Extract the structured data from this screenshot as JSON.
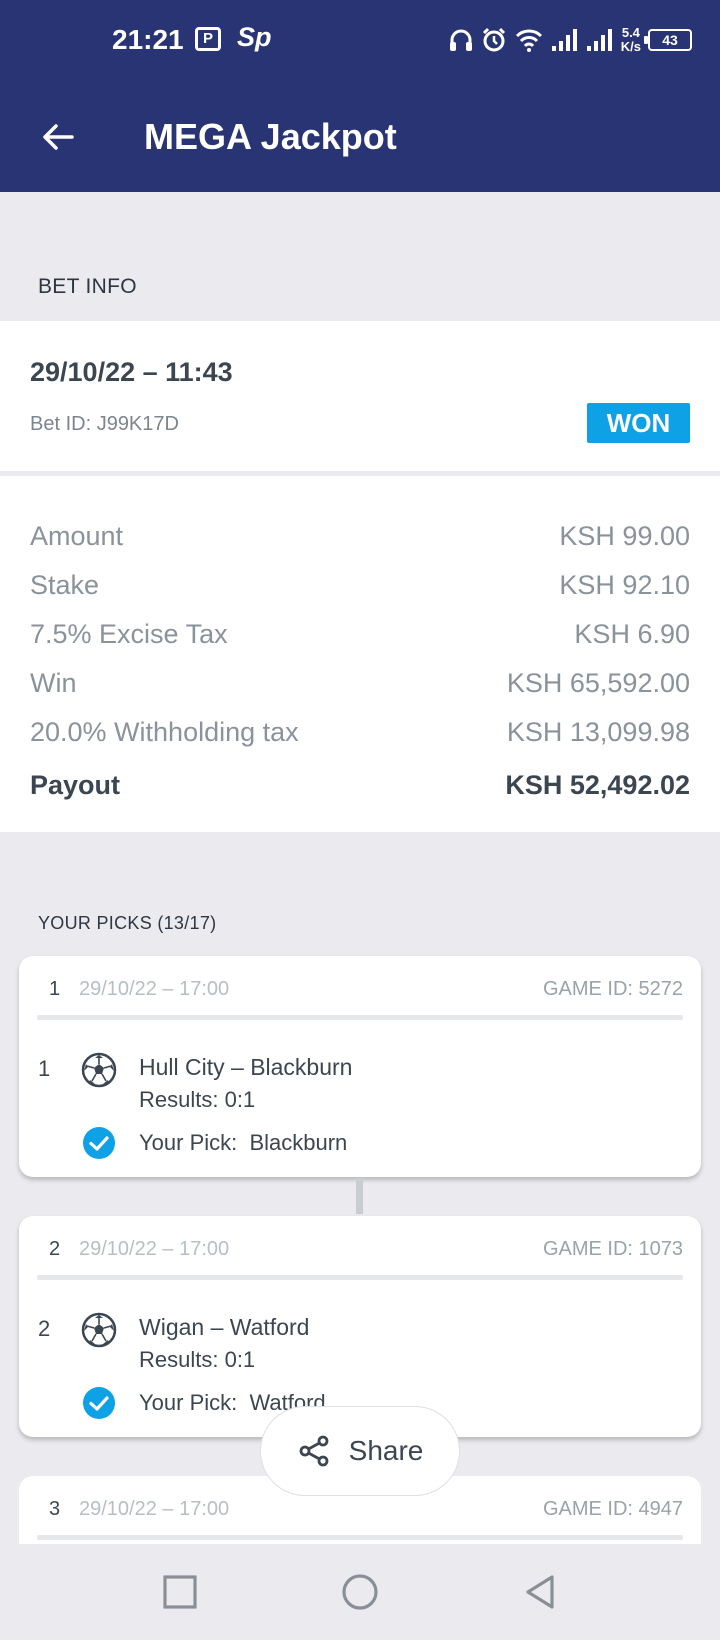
{
  "status_bar": {
    "time": "21:21",
    "app_icon_1": "P",
    "app_icon_2": "Sp",
    "speed_value": "5.4",
    "speed_unit": "K/s",
    "battery": "43",
    "icons": [
      "headphones-icon",
      "alarm-icon",
      "wifi-icon",
      "signal-icon",
      "signal-icon"
    ]
  },
  "header": {
    "back_icon": "arrow-left-icon",
    "title": "MEGA Jackpot",
    "background_color": "#283474"
  },
  "bet_info": {
    "section_title": "BET INFO",
    "datetime": "29/10/22 – 11:43",
    "bet_id": "Bet ID: J99K17D",
    "status_badge": "WON",
    "badge_color": "#0ea1e6"
  },
  "amounts": [
    {
      "label": "Amount",
      "value": "KSH 99.00"
    },
    {
      "label": "Stake",
      "value": "KSH 92.10"
    },
    {
      "label": "7.5% Excise Tax",
      "value": "KSH 6.90"
    },
    {
      "label": "Win",
      "value": "KSH 65,592.00"
    },
    {
      "label": "20.0% Withholding tax",
      "value": "KSH 13,099.98"
    },
    {
      "label": "Payout",
      "value": "KSH 52,492.02"
    }
  ],
  "picks": {
    "section_title": "YOUR PICKS (13/17)",
    "items": [
      {
        "number": "1",
        "date": "29/10/22 – 17:00",
        "game_id": "GAME ID: 5272",
        "index": "1",
        "match": "Hull City – Blackburn",
        "result": "Results: 0:1",
        "pick": "Your Pick:  Blackburn"
      },
      {
        "number": "2",
        "date": "29/10/22 – 17:00",
        "game_id": "GAME ID: 1073",
        "index": "2",
        "match": "Wigan – Watford",
        "result": "Results: 0:1",
        "pick": "Your Pick:  Watford"
      },
      {
        "number": "3",
        "date": "29/10/22 – 17:00",
        "game_id": "GAME ID: 4947"
      }
    ]
  },
  "share": {
    "label": "Share",
    "icon": "share-icon"
  },
  "nav": {
    "icons": [
      "recents-square-icon",
      "home-circle-icon",
      "back-triangle-icon"
    ]
  }
}
